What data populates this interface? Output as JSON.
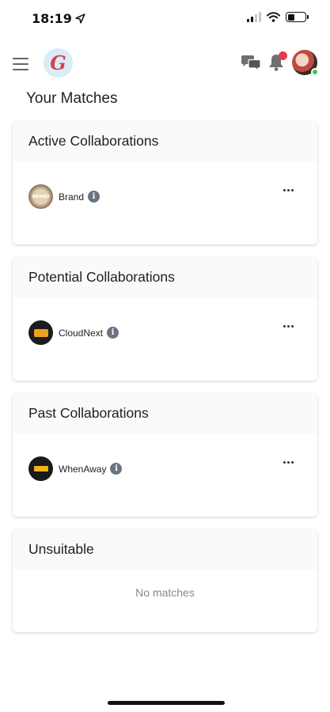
{
  "status_bar": {
    "time": "18:19"
  },
  "header": {
    "logo_letter": "G"
  },
  "page": {
    "title": "Your Matches"
  },
  "sections": [
    {
      "title": "Active Collaborations",
      "match": {
        "name": "Brand",
        "logo_text": "BRAND"
      }
    },
    {
      "title": "Potential Collaborations",
      "match": {
        "name": "CloudNext"
      }
    },
    {
      "title": "Past Collaborations",
      "match": {
        "name": "WhenAway"
      }
    },
    {
      "title": "Unsuitable",
      "empty_text": "No matches"
    }
  ],
  "icons": {
    "info": "i",
    "colors": {
      "notification": "#e33b4b",
      "online": "#34c759",
      "logo_bg": "#d9ecf7",
      "logo_fg": "#d9414a"
    }
  }
}
